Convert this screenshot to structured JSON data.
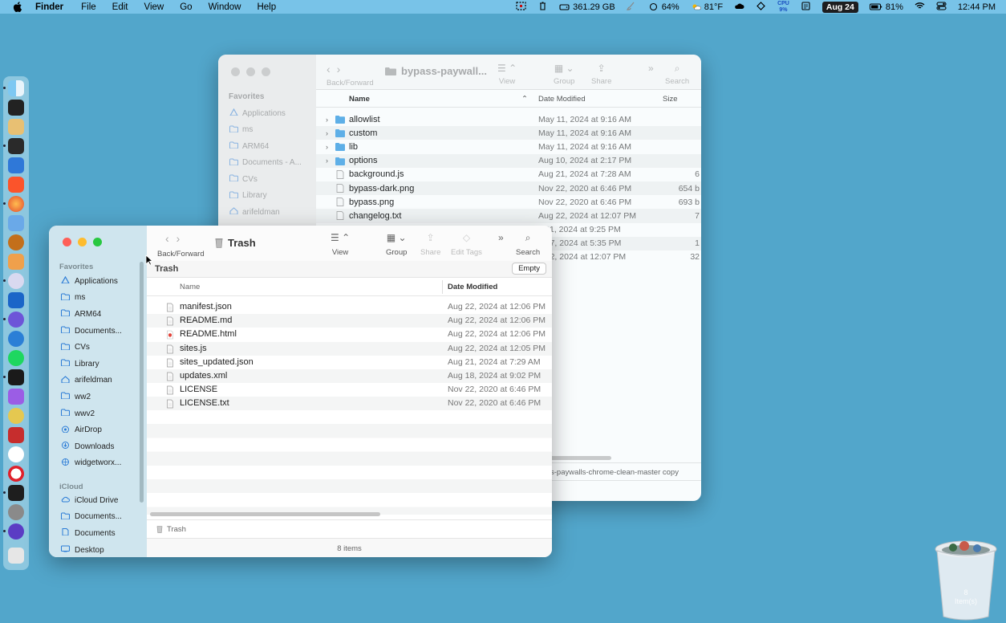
{
  "menubar": {
    "app": "Finder",
    "menus": [
      "File",
      "Edit",
      "View",
      "Go",
      "Window",
      "Help"
    ],
    "disk": "361.29 GB",
    "battery_small": "64%",
    "weather": "81°F",
    "cpu": "9%",
    "cpu_label": "CPU",
    "date": "Aug 24",
    "battery": "81%",
    "time": "12:44 PM"
  },
  "back_window": {
    "title": "bypass-paywall...",
    "nav_label": "Back/Forward",
    "buttons": {
      "view": "View",
      "group": "Group",
      "share": "Share",
      "search": "Search"
    },
    "sidebar_section": "Favorites",
    "sidebar_items": [
      "Applications",
      "ms",
      "ARM64",
      "Documents - A...",
      "CVs",
      "Library",
      "arifeldman"
    ],
    "columns": {
      "name": "Name",
      "date": "Date Modified",
      "size": "Size"
    },
    "rows": [
      {
        "name": "allowlist",
        "date": "May 11, 2024 at 9:16 AM",
        "size": "",
        "folder": true
      },
      {
        "name": "custom",
        "date": "May 11, 2024 at 9:16 AM",
        "size": "",
        "folder": true
      },
      {
        "name": "lib",
        "date": "May 11, 2024 at 9:16 AM",
        "size": "",
        "folder": true
      },
      {
        "name": "options",
        "date": "Aug 10, 2024 at 2:17 PM",
        "size": "",
        "folder": true
      },
      {
        "name": "background.js",
        "date": "Aug 21, 2024 at 7:28 AM",
        "size": "6",
        "folder": false
      },
      {
        "name": "bypass-dark.png",
        "date": "Nov 22, 2020 at 6:46 PM",
        "size": "654 b",
        "folder": false
      },
      {
        "name": "bypass.png",
        "date": "Nov 22, 2020 at 6:46 PM",
        "size": "693 b",
        "folder": false
      },
      {
        "name": "changelog.txt",
        "date": "Aug 22, 2024 at 12:07 PM",
        "size": "7",
        "folder": false
      },
      {
        "name": "",
        "date": "y 21, 2024 at 9:25 PM",
        "size": "",
        "folder": false
      },
      {
        "name": "",
        "date": "g 17, 2024 at 5:35 PM",
        "size": "1",
        "folder": false
      },
      {
        "name": "",
        "date": "g 22, 2024 at 12:07 PM",
        "size": "32",
        "folder": false
      }
    ],
    "path": "s-paywalls-chrome-clean-master copy"
  },
  "front_window": {
    "title": "Trash",
    "nav_label": "Back/Forward",
    "buttons": {
      "view": "View",
      "group": "Group",
      "share": "Share",
      "edit_tags": "Edit Tags",
      "search": "Search"
    },
    "location": "Trash",
    "empty_label": "Empty",
    "sidebar_sections": {
      "favorites": "Favorites",
      "icloud": "iCloud"
    },
    "favorites": [
      {
        "label": "Applications",
        "icon": "applications-icon"
      },
      {
        "label": "ms",
        "icon": "folder-icon"
      },
      {
        "label": "ARM64",
        "icon": "folder-icon"
      },
      {
        "label": "Documents...",
        "icon": "folder-icon"
      },
      {
        "label": "CVs",
        "icon": "folder-icon"
      },
      {
        "label": "Library",
        "icon": "folder-icon"
      },
      {
        "label": "arifeldman",
        "icon": "home-icon"
      },
      {
        "label": "ww2",
        "icon": "folder-icon"
      },
      {
        "label": "wwv2",
        "icon": "folder-icon"
      },
      {
        "label": "AirDrop",
        "icon": "airdrop-icon"
      },
      {
        "label": "Downloads",
        "icon": "downloads-icon"
      },
      {
        "label": "widgetworx...",
        "icon": "globe-icon"
      }
    ],
    "icloud": [
      {
        "label": "iCloud Drive",
        "icon": "cloud-icon"
      },
      {
        "label": "Documents...",
        "icon": "folder-icon"
      },
      {
        "label": "Documents",
        "icon": "doc-icon"
      },
      {
        "label": "Desktop",
        "icon": "desktop-icon"
      }
    ],
    "columns": {
      "name": "Name",
      "date": "Date Modified"
    },
    "rows": [
      {
        "name": "manifest.json",
        "date": "Aug 22, 2024 at 12:06 PM"
      },
      {
        "name": "README.md",
        "date": "Aug 22, 2024 at 12:06 PM"
      },
      {
        "name": "README.html",
        "date": "Aug 22, 2024 at 12:06 PM"
      },
      {
        "name": "sites.js",
        "date": "Aug 22, 2024 at 12:05 PM"
      },
      {
        "name": "sites_updated.json",
        "date": "Aug 21, 2024 at 7:29 AM"
      },
      {
        "name": "updates.xml",
        "date": "Aug 18, 2024 at 9:02 PM"
      },
      {
        "name": "LICENSE",
        "date": "Nov 22, 2020 at 6:46 PM"
      },
      {
        "name": "LICENSE.txt",
        "date": "Nov 22, 2020 at 6:46 PM"
      }
    ],
    "path": "Trash",
    "status": "8 items"
  },
  "desktop_trash": {
    "count": "8",
    "label": "Item(s)"
  },
  "colors": {
    "desktop": "#52a6cb",
    "menubar": "#78c3e8",
    "sidebar": "#cfe5ee",
    "folder": "#5fb0e8"
  }
}
